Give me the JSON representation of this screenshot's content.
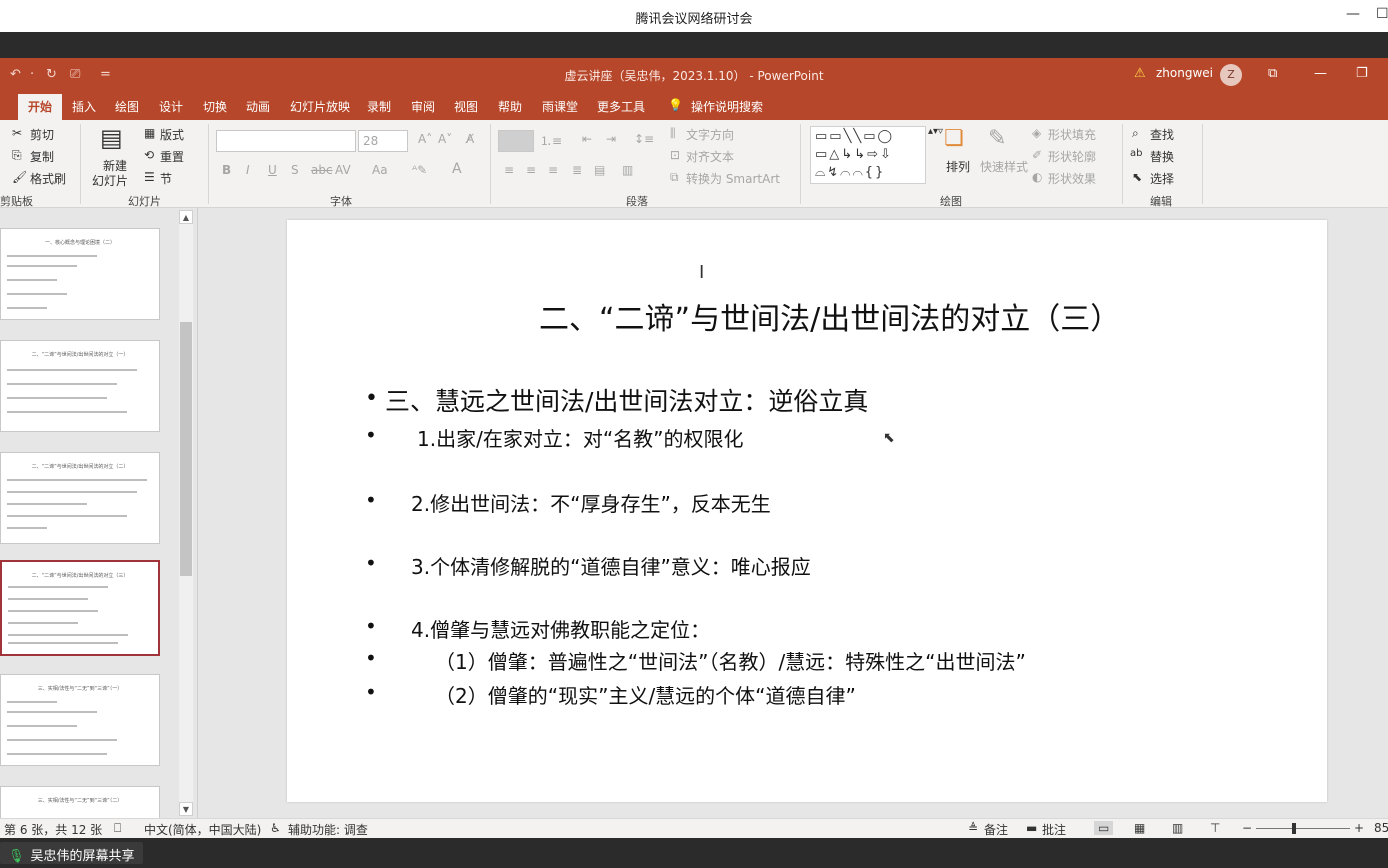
{
  "meeting": {
    "window_title": "腾讯会议网络研讨会",
    "min_glyph": "—",
    "max_glyph": "☐",
    "share_label": "吴忠伟的屏幕共享",
    "mic_glyph": "🎙"
  },
  "powerpoint": {
    "doc_title": "虚云讲座（吴忠伟，2023.1.10） - PowerPoint",
    "user": "zhongwei",
    "avatar_letter": "Z",
    "warn_glyph": "⚠",
    "quick_access": [
      "↶",
      "·",
      "↻",
      "⎚",
      "="
    ],
    "window_controls": [
      "⧉",
      "—",
      "❐"
    ]
  },
  "tabs": [
    {
      "label": "开始",
      "active": true
    },
    {
      "label": "插入"
    },
    {
      "label": "绘图"
    },
    {
      "label": "设计"
    },
    {
      "label": "切换"
    },
    {
      "label": "动画"
    },
    {
      "label": "幻灯片放映"
    },
    {
      "label": "录制"
    },
    {
      "label": "审阅"
    },
    {
      "label": "视图"
    },
    {
      "label": "帮助"
    },
    {
      "label": "雨课堂"
    },
    {
      "label": "更多工具"
    },
    {
      "label": "操作说明搜索"
    }
  ],
  "ribbon": {
    "clipboard": {
      "cut": "剪切",
      "copy": "复制",
      "format_painter": "格式刷",
      "group": "剪贴板"
    },
    "slides": {
      "new_slide": "新建",
      "new_slide_2": "幻灯片",
      "layout": "版式",
      "reset": "重置",
      "section": "节",
      "group": "幻灯片"
    },
    "font": {
      "size": "28",
      "group": "字体",
      "buttons": [
        "B",
        "I",
        "U",
        "S",
        "abc",
        "AV",
        "Aa",
        "A"
      ]
    },
    "paragraph": {
      "text_direction": "文字方向",
      "align_text": "对齐文本",
      "smartart": "转换为 SmartArt",
      "group": "段落"
    },
    "drawing": {
      "arrange": "排列",
      "quick_styles": "快速样式",
      "fill": "形状填充",
      "outline": "形状轮廓",
      "effects": "形状效果",
      "group": "绘图"
    },
    "editing": {
      "find": "查找",
      "replace": "替换",
      "select": "选择",
      "group": "编辑"
    }
  },
  "thumbnails": [
    {
      "title": "一、核心概念与理论困境（二）"
    },
    {
      "title": "二、“二谛”与世间法/出世间法的对立（一）"
    },
    {
      "title": "二、“二谛”与世间法/出世间法的对立（二）"
    },
    {
      "title": "二、“二谛”与世间法/出世间法的对立（三）",
      "selected": true
    },
    {
      "title": "三、实相/法性与“二无”到“三谛”（一）"
    },
    {
      "title": "三、实相/法性与“二无”到“三谛”（二）"
    }
  ],
  "slide": {
    "title": "二、“二谛”与世间法/出世间法的对立（三）",
    "bullets": [
      "三、慧远之世间法/出世间法对立：逆俗立真",
      "1.出家/在家对立：对“名教”的权限化",
      "2.修出世间法：不“厚身存生”，反本无生",
      "3.个体清修解脱的“道德自律”意义：唯心报应",
      "4.僧肇与慧远对佛教职能之定位：",
      "（1）僧肇：普遍性之“世间法”（名教）/慧远：特殊性之“出世间法”",
      "（2）僧肇的“现实”主义/慧远的个体“道德自律”"
    ],
    "bullet_glyph": "•"
  },
  "statusbar": {
    "slide_info": "第 6 张，共 12 张",
    "language": "中文(简体，中国大陆)",
    "accessibility": "辅助功能: 调查",
    "notes": "备注",
    "comments": "批注",
    "zoom": "85"
  }
}
